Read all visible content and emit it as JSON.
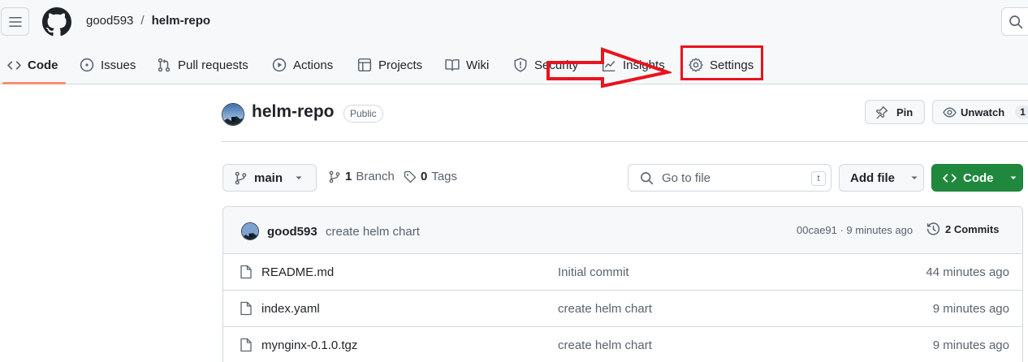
{
  "header": {
    "owner": "good593",
    "separator": "/",
    "repo": "helm-repo"
  },
  "repo_nav": {
    "tabs": [
      {
        "label": "Code",
        "icon": "code-icon",
        "active": true
      },
      {
        "label": "Issues",
        "icon": "issue-opened-icon"
      },
      {
        "label": "Pull requests",
        "icon": "git-pull-request-icon"
      },
      {
        "label": "Actions",
        "icon": "play-icon"
      },
      {
        "label": "Projects",
        "icon": "table-icon"
      },
      {
        "label": "Wiki",
        "icon": "book-icon"
      },
      {
        "label": "Security",
        "icon": "shield-icon"
      },
      {
        "label": "Insights",
        "icon": "graph-icon"
      },
      {
        "label": "Settings",
        "icon": "gear-icon"
      }
    ]
  },
  "repo_header": {
    "name": "helm-repo",
    "visibility": "Public",
    "pin_label": "Pin",
    "watch_label": "Unwatch",
    "watch_count": "1"
  },
  "branch_bar": {
    "branch": "main",
    "branches_count": "1",
    "branches_label": "Branch",
    "tags_count": "0",
    "tags_label": "Tags",
    "search_placeholder": "Go to file",
    "search_shortcut": "t",
    "add_file_label": "Add file",
    "code_label": "Code"
  },
  "latest_commit": {
    "author": "good593",
    "message": "create helm chart",
    "sha_time": "00cae91 · 9 minutes ago",
    "commits_label": "2 Commits"
  },
  "files": [
    {
      "name": "README.md",
      "commit": "Initial commit",
      "age": "44 minutes ago"
    },
    {
      "name": "index.yaml",
      "commit": "create helm chart",
      "age": "9 minutes ago"
    },
    {
      "name": "mynginx-0.1.0.tgz",
      "commit": "create helm chart",
      "age": "9 minutes ago"
    }
  ],
  "colors": {
    "primary_button": "#1f883d",
    "active_tab_underline": "#fd8c73",
    "annotation_red": "#e8141e",
    "header_bg": "#f6f8fa"
  }
}
